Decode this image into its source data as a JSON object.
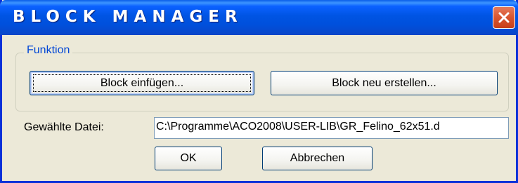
{
  "window": {
    "title": "BLOCK MANAGER"
  },
  "function_group": {
    "label": "Funktion",
    "insert_button": "Block einfügen...",
    "create_button": "Block neu erstellen..."
  },
  "file": {
    "label": "Gewählte Datei:",
    "value": "C:\\Programme\\ACO2008\\USER-LIB\\GR_Felino_62x51.d"
  },
  "actions": {
    "ok": "OK",
    "cancel": "Abbrechen"
  }
}
